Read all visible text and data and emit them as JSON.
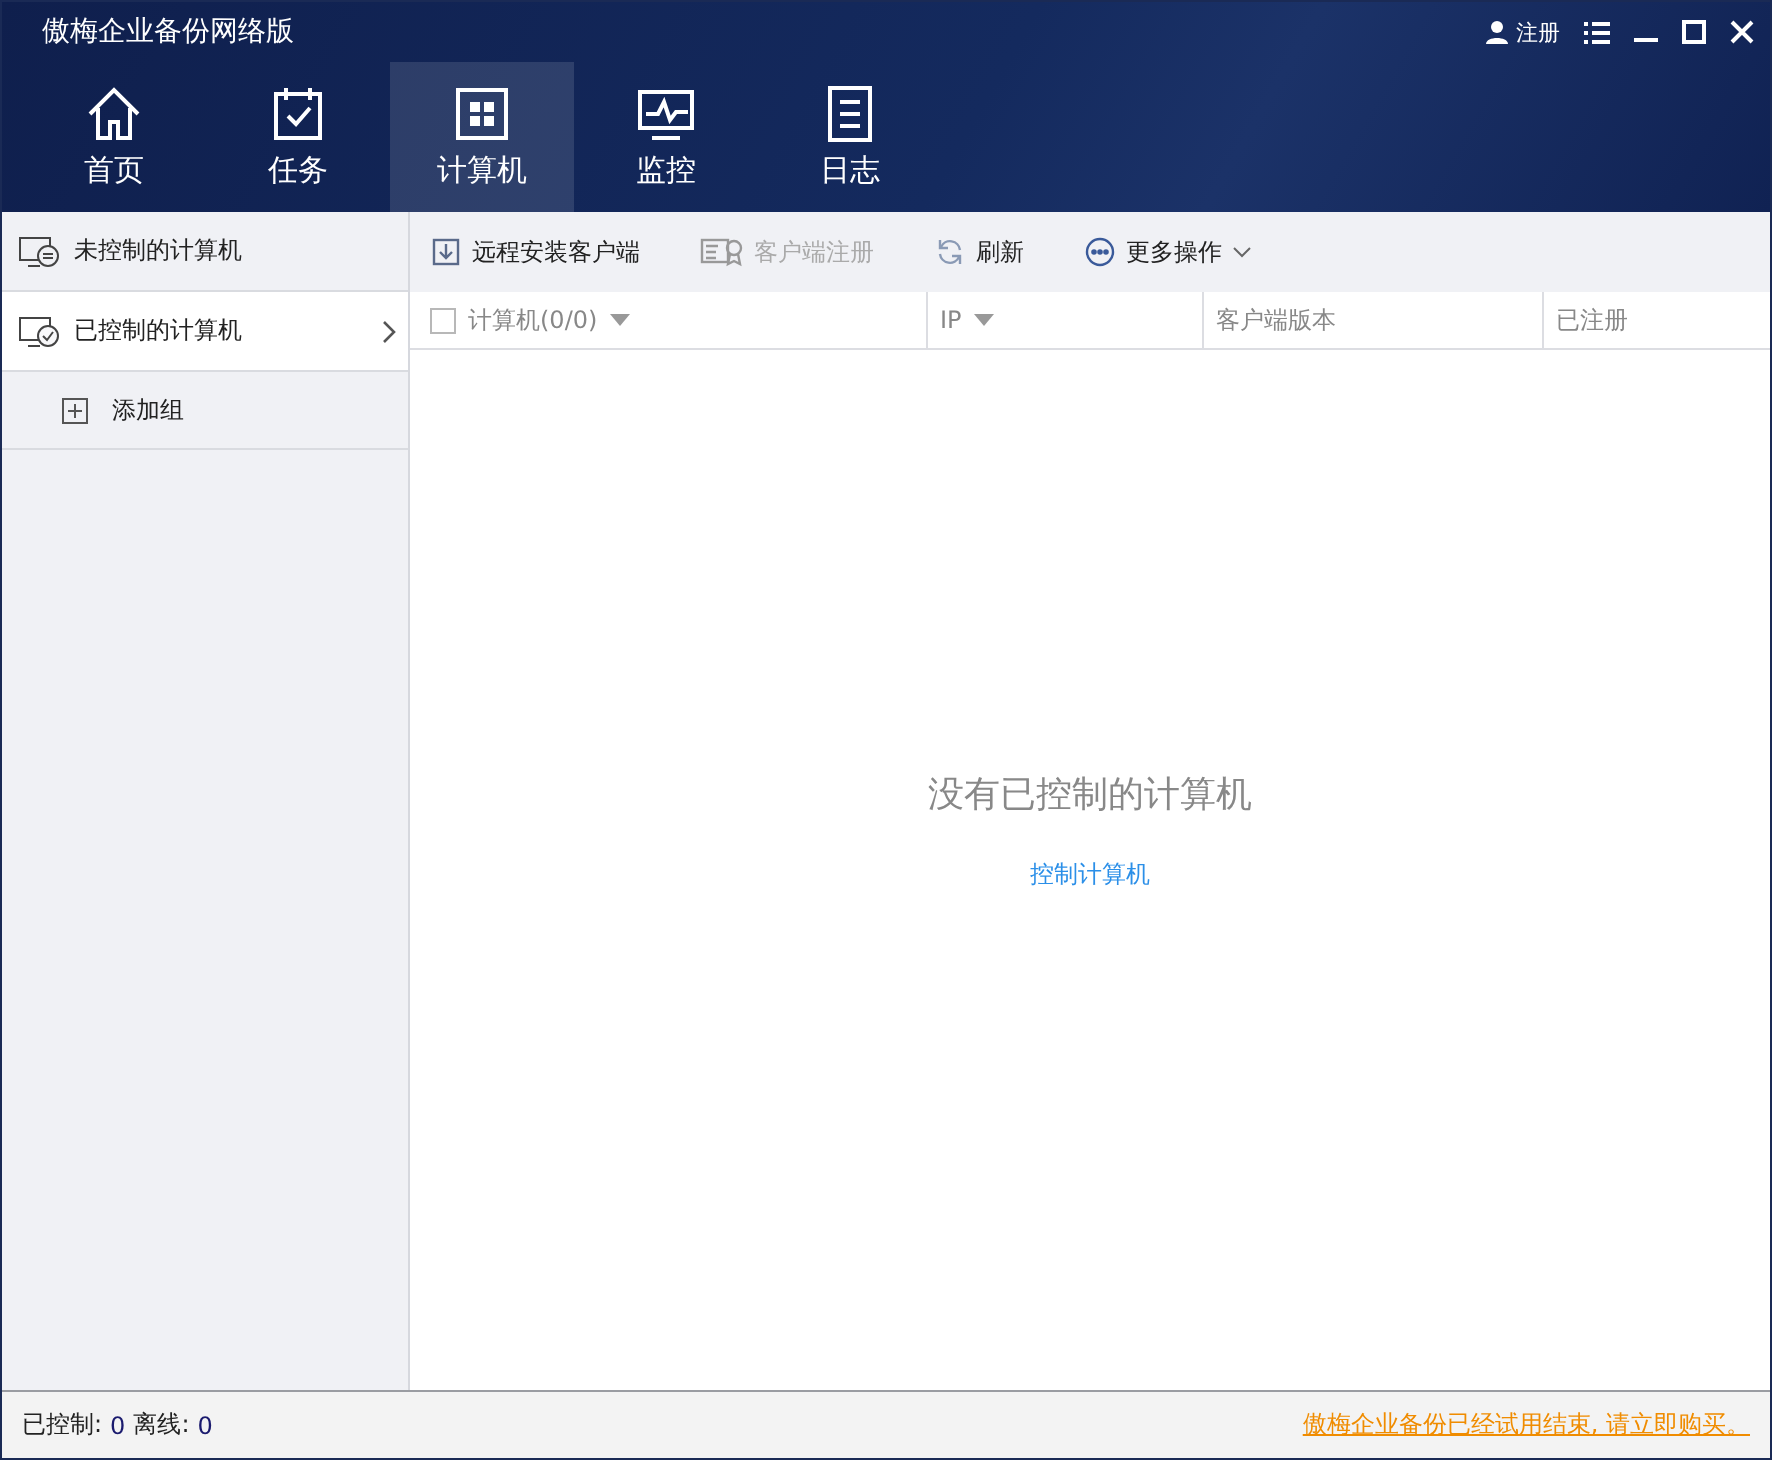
{
  "window": {
    "title": "傲梅企业备份网络版",
    "register": "注册"
  },
  "nav": [
    {
      "label": "首页",
      "kind": "home",
      "selected": false
    },
    {
      "label": "任务",
      "kind": "task",
      "selected": false
    },
    {
      "label": "计算机",
      "kind": "computer",
      "selected": true
    },
    {
      "label": "监控",
      "kind": "monitor",
      "selected": false
    },
    {
      "label": "日志",
      "kind": "log",
      "selected": false
    }
  ],
  "sidebar": {
    "items": [
      {
        "label": "未控制的计算机",
        "kind": "uncontrolled",
        "selected": false,
        "expandable": false
      },
      {
        "label": "已控制的计算机",
        "kind": "controlled",
        "selected": true,
        "expandable": true
      }
    ],
    "add_group": "添加组"
  },
  "toolbar": [
    {
      "label": "远程安装客户端",
      "kind": "install",
      "disabled": false
    },
    {
      "label": "客户端注册",
      "kind": "register",
      "disabled": true
    },
    {
      "label": "刷新",
      "kind": "refresh",
      "disabled": false
    },
    {
      "label": "更多操作",
      "kind": "more",
      "disabled": false
    }
  ],
  "table": {
    "checked": false,
    "columns": [
      {
        "label": "计算机(0/0)",
        "sortable": true
      },
      {
        "label": "IP",
        "sortable": true
      },
      {
        "label": "客户端版本",
        "sortable": false
      },
      {
        "label": "已注册",
        "sortable": false
      }
    ]
  },
  "empty": {
    "message": "没有已控制的计算机",
    "link": "控制计算机"
  },
  "status_bar": {
    "controlled_label": "已控制:",
    "controlled": "0",
    "offline_label": "离线:",
    "offline": "0",
    "trial_notice": "傲梅企业备份已经试用结束, 请立即购买。"
  }
}
